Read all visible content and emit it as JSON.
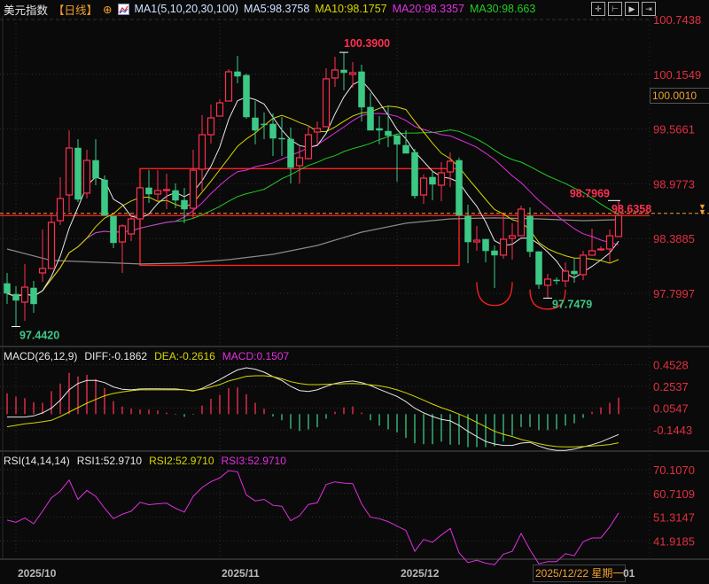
{
  "header": {
    "title": "美元指数",
    "period": "【日线】",
    "ma_label": "MA1(5,10,20,30,100)",
    "ma5": "MA5:98.3758",
    "ma10": "MA10:98.1757",
    "ma20": "MA20:98.3357",
    "ma30": "MA30:98.663"
  },
  "toolbar_icons": [
    "crosshair-icon",
    "range-select-icon",
    "play-icon",
    "exit-icon"
  ],
  "macd_header": {
    "label": "MACD(26,12,9)",
    "diff": "DIFF:-0.1862",
    "dea": "DEA:-0.2616",
    "macd": "MACD:0.1507"
  },
  "rsi_header": {
    "label": "RSI(14,14,14)",
    "rsi1": "RSI1:52.9710",
    "rsi2": "RSI2:52.9710",
    "rsi3": "RSI3:52.9710"
  },
  "crosshair_price": "100.0010",
  "x_axis": {
    "ticks": [
      "2025/10",
      "2025/11",
      "2025/12"
    ],
    "tick_index": [
      1,
      24,
      44
    ],
    "crosshair_date": "2025/12/22 星期一",
    "next_label": "01"
  },
  "colors": {
    "up": "#ff3050",
    "down": "#3cc986",
    "ma5": "#e8e8e8",
    "ma10": "#d6d600",
    "ma20": "#e030e0",
    "ma30": "#22cc22",
    "ma100": "#8a8a8a",
    "axis_text": "#e03040",
    "annotation": "#ff2020",
    "crosshair": "#f0a030",
    "background": "#0a0a0a"
  },
  "chart_data": [
    {
      "type": "candlestick",
      "y_ticks": [
        "100.7438",
        "100.1549",
        "99.5661",
        "98.9773",
        "98.3885",
        "97.7997"
      ],
      "ylim": [
        97.4,
        100.75
      ],
      "ma_periods": [
        5,
        10,
        20,
        30
      ],
      "open": [
        97.905,
        97.79,
        97.705,
        97.857,
        98.019,
        98.067,
        98.581,
        98.857,
        99.362,
        98.877,
        99.229,
        99.019,
        98.629,
        98.352,
        98.438,
        98.6,
        98.934,
        98.867,
        98.905,
        98.905,
        98.8,
        98.714,
        99.134,
        99.505,
        99.705,
        99.867,
        100.182,
        100.144,
        99.686,
        99.62,
        99.62,
        99.467,
        99.458,
        99.172,
        99.248,
        99.534,
        99.591,
        100.115,
        100.201,
        100.153,
        100.182,
        99.801,
        99.572,
        99.543,
        99.496,
        99.391,
        99.315,
        98.857,
        99.048,
        98.962,
        99.105,
        99.229,
        98.629,
        98.352,
        98.381,
        98.257,
        98.21,
        98.391,
        98.419,
        98.629,
        98.248,
        97.886,
        97.943,
        97.933,
        98.038,
        98.0,
        98.21,
        98.267,
        98.276,
        98.41
      ],
      "high": [
        98.019,
        97.876,
        98.114,
        97.933,
        98.486,
        98.648,
        99.048,
        99.553,
        99.458,
        99.343,
        99.458,
        99.067,
        98.629,
        98.543,
        98.638,
        98.953,
        99.124,
        99.124,
        99.086,
        98.981,
        98.934,
        99.343,
        99.715,
        99.829,
        99.886,
        100.21,
        100.353,
        100.163,
        99.867,
        99.744,
        99.734,
        99.696,
        99.582,
        99.381,
        99.591,
        99.648,
        100.22,
        100.344,
        100.39,
        100.287,
        100.258,
        99.953,
        99.705,
        99.82,
        99.496,
        99.553,
        99.353,
        99.077,
        99.115,
        99.21,
        99.315,
        99.258,
        98.753,
        98.524,
        98.381,
        98.314,
        98.648,
        98.553,
        98.743,
        98.724,
        98.248,
        98.009,
        97.971,
        98.133,
        98.171,
        98.257,
        98.495,
        98.305,
        98.486,
        98.797
      ],
      "low": [
        97.686,
        97.442,
        97.504,
        97.59,
        97.924,
        98.06,
        98.534,
        98.676,
        98.781,
        98.819,
        98.962,
        98.638,
        98.286,
        98.019,
        98.362,
        98.381,
        98.772,
        98.791,
        98.705,
        98.714,
        98.553,
        98.6,
        98.905,
        99.41,
        99.705,
        99.867,
        100.058,
        99.677,
        99.401,
        99.458,
        99.277,
        99.277,
        98.981,
        98.981,
        99.239,
        99.41,
        99.591,
        100.02,
        99.982,
        100.01,
        99.648,
        99.553,
        99.401,
        99.372,
        99.0,
        99.305,
        98.819,
        98.762,
        98.8,
        98.791,
        98.943,
        98.638,
        98.124,
        98.257,
        98.133,
        97.857,
        98.171,
        98.162,
        98.419,
        98.19,
        97.847,
        97.748,
        97.895,
        97.866,
        97.914,
        97.943,
        98.21,
        98.257,
        98.133,
        98.41
      ],
      "close": [
        97.8,
        97.724,
        97.866,
        97.686,
        98.067,
        98.562,
        98.819,
        99.362,
        98.81,
        99.229,
        99.038,
        98.638,
        98.343,
        98.524,
        98.6,
        98.934,
        98.867,
        98.905,
        98.915,
        98.8,
        98.705,
        99.124,
        99.505,
        99.686,
        99.848,
        100.182,
        100.134,
        99.696,
        99.553,
        99.61,
        99.467,
        99.458,
        99.153,
        99.258,
        99.505,
        99.572,
        100.106,
        100.201,
        100.172,
        100.172,
        99.801,
        99.553,
        99.553,
        99.496,
        99.401,
        99.305,
        98.848,
        99.038,
        98.972,
        99.096,
        99.22,
        98.638,
        98.352,
        98.371,
        98.257,
        98.21,
        98.381,
        98.419,
        98.705,
        98.248,
        97.895,
        97.952,
        97.933,
        98.038,
        98.009,
        98.21,
        98.257,
        98.276,
        98.419,
        98.636
      ],
      "ma100_samples": {
        "every": 5,
        "values": [
          98.276,
          98.153,
          98.134,
          98.115,
          98.124,
          98.162,
          98.219,
          98.314,
          98.457,
          98.553,
          98.6,
          98.61,
          98.6,
          98.581,
          98.591
        ]
      },
      "reference_line_price": 98.66,
      "annotations": [
        {
          "type": "label",
          "text": "100.3900",
          "index": 38,
          "price": 100.39,
          "color": "#ff3050"
        },
        {
          "type": "label",
          "text": "97.4420",
          "index": 1,
          "price": 97.442,
          "color": "#3cc986"
        },
        {
          "type": "label",
          "text": "97.7479",
          "index": 61,
          "price": 97.748,
          "color": "#3cc986"
        },
        {
          "type": "label",
          "text": "98.7969",
          "index": 69,
          "price": 98.797,
          "color": "#ff3050"
        },
        {
          "type": "label",
          "text": "98.6358",
          "index": 69,
          "price": 98.636,
          "color": "#ff3050"
        },
        {
          "type": "box",
          "from_index": 15,
          "to_index": 51,
          "top": 99.14,
          "bottom": 98.1
        },
        {
          "type": "arc",
          "from_index": 53,
          "to_index": 57,
          "top": 97.92,
          "bottom": 97.67
        },
        {
          "type": "arc",
          "from_index": 59,
          "to_index": 63,
          "top": 97.84,
          "bottom": 97.63
        }
      ]
    },
    {
      "type": "bar+line",
      "name": "MACD",
      "y_ticks": [
        "0.4528",
        "0.2537",
        "0.0547",
        "-0.1443"
      ],
      "diff": [
        -0.027,
        -0.027,
        -0.027,
        -0.016,
        0.011,
        0.054,
        0.127,
        0.222,
        0.281,
        0.308,
        0.308,
        0.289,
        0.249,
        0.227,
        0.222,
        0.23,
        0.232,
        0.232,
        0.23,
        0.23,
        0.222,
        0.211,
        0.235,
        0.276,
        0.316,
        0.362,
        0.405,
        0.424,
        0.411,
        0.384,
        0.343,
        0.308,
        0.254,
        0.216,
        0.208,
        0.222,
        0.254,
        0.281,
        0.295,
        0.303,
        0.289,
        0.262,
        0.227,
        0.195,
        0.162,
        0.114,
        0.054,
        0.011,
        -0.022,
        -0.049,
        -0.062,
        -0.103,
        -0.157,
        -0.205,
        -0.251,
        -0.273,
        -0.286,
        -0.286,
        -0.265,
        -0.259,
        -0.292,
        -0.319,
        -0.332,
        -0.332,
        -0.32,
        -0.3,
        -0.28,
        -0.255,
        -0.22,
        -0.1862
      ],
      "dea": [
        -0.116,
        -0.103,
        -0.089,
        -0.081,
        -0.07,
        -0.057,
        -0.022,
        0.019,
        0.059,
        0.1,
        0.135,
        0.168,
        0.189,
        0.203,
        0.214,
        0.222,
        0.222,
        0.222,
        0.222,
        0.222,
        0.222,
        0.216,
        0.227,
        0.249,
        0.27,
        0.303,
        0.324,
        0.346,
        0.351,
        0.351,
        0.343,
        0.324,
        0.297,
        0.281,
        0.27,
        0.27,
        0.273,
        0.276,
        0.278,
        0.281,
        0.276,
        0.268,
        0.259,
        0.243,
        0.222,
        0.195,
        0.162,
        0.127,
        0.092,
        0.059,
        0.032,
        0.0,
        -0.035,
        -0.076,
        -0.116,
        -0.157,
        -0.184,
        -0.205,
        -0.232,
        -0.251,
        -0.27,
        -0.286,
        -0.297,
        -0.3,
        -0.3,
        -0.297,
        -0.292,
        -0.286,
        -0.278,
        -0.2616
      ],
      "macd": [
        0.19,
        0.16,
        0.146,
        0.109,
        0.104,
        0.21,
        0.28,
        0.378,
        0.345,
        0.359,
        0.322,
        0.238,
        0.118,
        0.07,
        0.05,
        0.042,
        0.042,
        0.034,
        0.014,
        -0.005,
        -0.025,
        -0.005,
        0.078,
        0.14,
        0.177,
        0.238,
        0.244,
        0.182,
        0.104,
        0.05,
        -0.022,
        -0.056,
        -0.134,
        -0.154,
        -0.14,
        -0.12,
        -0.042,
        0.022,
        0.062,
        0.07,
        0.014,
        -0.056,
        -0.106,
        -0.14,
        -0.168,
        -0.218,
        -0.266,
        -0.275,
        -0.275,
        -0.252,
        -0.28,
        -0.28,
        -0.302,
        -0.302,
        -0.302,
        -0.294,
        -0.252,
        -0.196,
        -0.118,
        -0.118,
        -0.146,
        -0.146,
        -0.14,
        -0.106,
        -0.084,
        -0.034,
        0.022,
        0.062,
        0.104,
        0.1507
      ]
    },
    {
      "type": "line",
      "name": "RSI",
      "y_ticks": [
        "70.1070",
        "60.7109",
        "51.3147",
        "41.9185"
      ],
      "rsi": [
        50.13,
        49.3,
        50.95,
        48.72,
        53.66,
        58.94,
        61.65,
        65.99,
        58.36,
        61.88,
        59.53,
        54.83,
        50.72,
        52.48,
        53.66,
        57.18,
        56.24,
        56.59,
        56.83,
        54.83,
        53.3,
        59.53,
        63.06,
        65.41,
        66.82,
        69.75,
        69.28,
        60.12,
        57.77,
        58.36,
        56.01,
        55.65,
        49.9,
        51.89,
        56.36,
        57.0,
        64.23,
        65.29,
        64.82,
        64.58,
        56.59,
        51.31,
        50.72,
        49.54,
        47.78,
        46.02,
        37.79,
        42.49,
        41.32,
        44.26,
        46.84,
        37.2,
        33.33,
        34.27,
        33.09,
        32.5,
        36.62,
        37.79,
        44.84,
        38.38,
        32.86,
        33.68,
        33.68,
        36.85,
        36.03,
        41.55,
        43.08,
        43.08,
        47.43,
        52.97
      ]
    }
  ]
}
